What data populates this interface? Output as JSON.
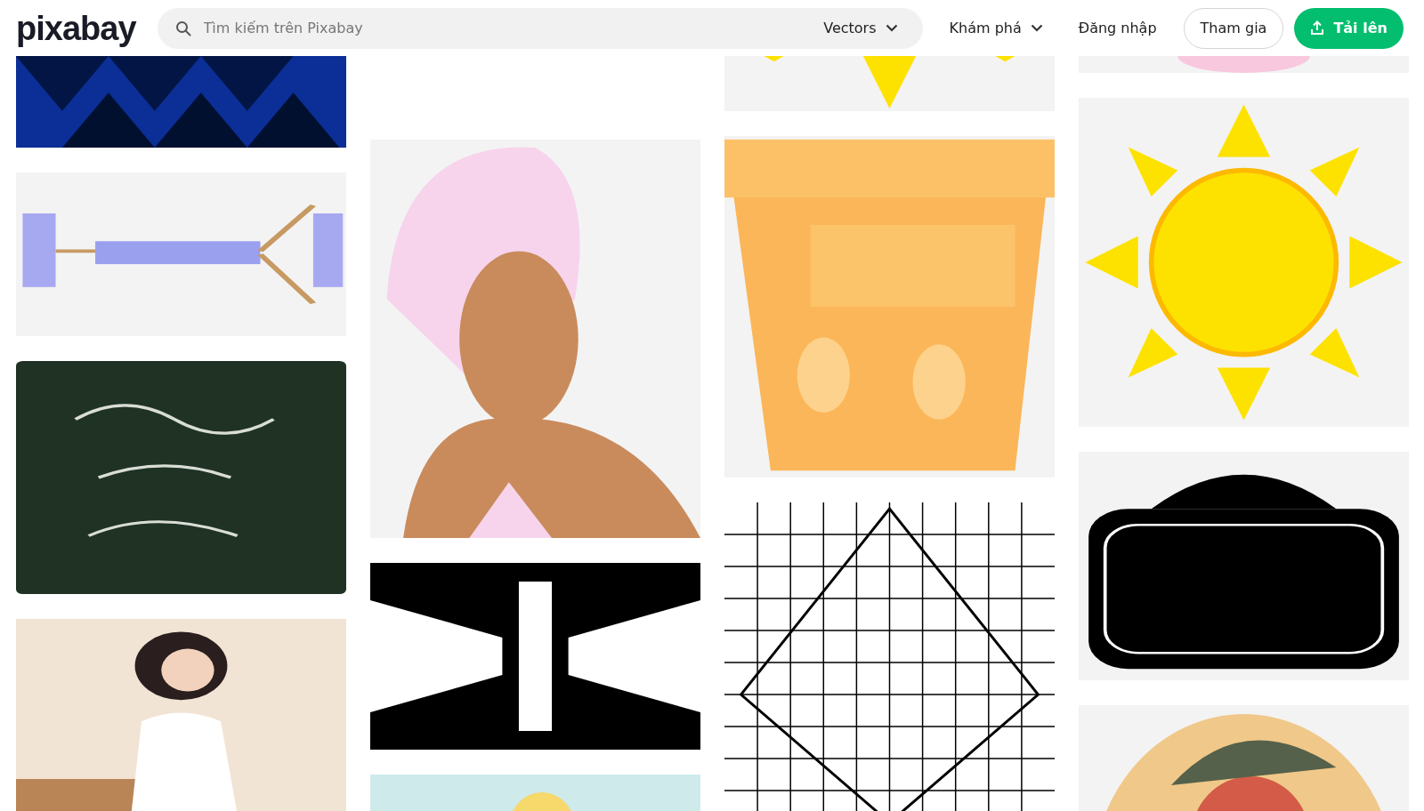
{
  "header": {
    "logo": "pixabay",
    "search": {
      "placeholder": "Tìm kiếm trên Pixabay",
      "filter": "Vectors"
    },
    "nav": [
      {
        "label": "Khám phá",
        "kind": "menu"
      },
      {
        "label": "Đăng nhập",
        "kind": "link"
      },
      {
        "label": "Tham gia",
        "kind": "outline"
      },
      {
        "label": "Tải lên",
        "kind": "upload"
      }
    ]
  }
}
